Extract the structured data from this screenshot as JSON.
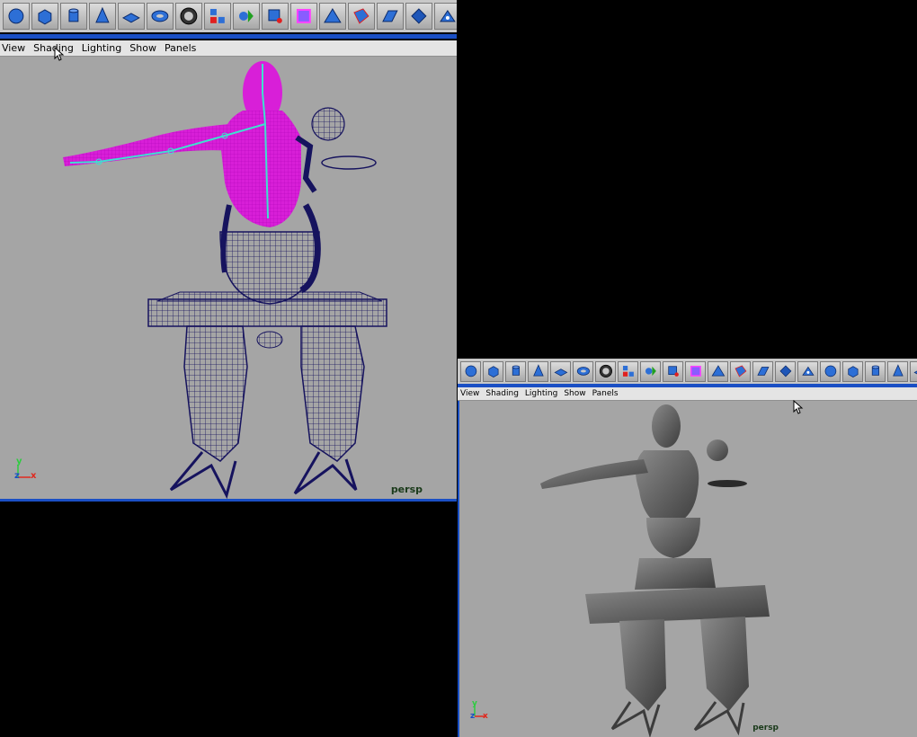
{
  "shelf_top": {
    "tools": [
      "polygon-sphere-icon",
      "polygon-cube-icon",
      "polygon-cylinder-icon",
      "polygon-cone-icon",
      "polygon-plane-icon",
      "polygon-torus-icon",
      "polygon-pipe-icon",
      "combine-icon",
      "separate-icon",
      "extract-icon",
      "smooth-proxy-icon",
      "subdiv-icon",
      "extrude-face-icon",
      "split-edge-icon",
      "wedge-face-icon",
      "poke-face-icon"
    ]
  },
  "shelf_bottom": {
    "tools": [
      "polygon-sphere-icon",
      "polygon-cube-icon",
      "polygon-cylinder-icon",
      "polygon-cone-icon",
      "polygon-plane-icon",
      "polygon-torus-icon",
      "polygon-pipe-icon",
      "combine-icon",
      "separate-icon",
      "extract-icon",
      "smooth-proxy-icon",
      "subdiv-icon",
      "extrude-face-icon",
      "split-edge-icon",
      "wedge-face-icon",
      "poke-face-icon",
      "duplicate-face-icon",
      "extrude-edge-icon",
      "bevel-icon",
      "merge-icon",
      "flip-icon",
      "fill-hole-icon"
    ]
  },
  "viewport_top": {
    "menu": [
      "View",
      "Shading",
      "Lighting",
      "Show",
      "Panels"
    ],
    "camera": "persp",
    "axis_labels": {
      "y": "y",
      "z": "z",
      "x": "x"
    }
  },
  "viewport_bottom": {
    "menu": [
      "View",
      "Shading",
      "Lighting",
      "Show",
      "Panels"
    ],
    "camera": "persp",
    "axis_labels": {
      "y": "y",
      "z": "z",
      "x": "x"
    }
  },
  "colors": {
    "panel_border": "#1a4fc4",
    "viewport_bg": "#a5a5a5",
    "wireframe": "#16135e",
    "skin_selected": "#d81fd8",
    "joint": "#3fe0d0",
    "shaded_mesh": "#5a5a5a"
  }
}
